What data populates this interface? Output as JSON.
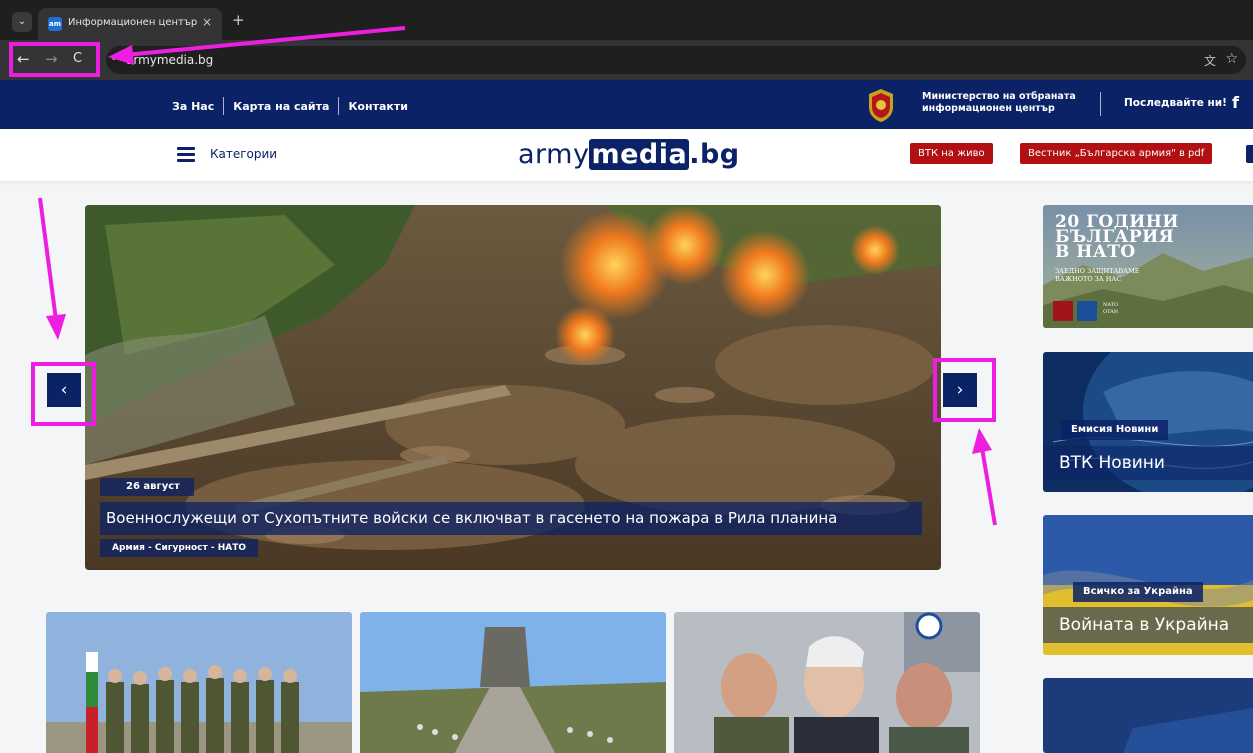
{
  "browser": {
    "tab_title": "Информационен център на М",
    "tab_close": "×",
    "new_tab": "+",
    "tab_menu": "⌄",
    "back": "←",
    "forward": "→",
    "reload": "C",
    "site_info": "⚯",
    "url": "armymedia.bg",
    "translate_icon": "文",
    "star_icon": "☆"
  },
  "topbar": {
    "links": [
      "За Нас",
      "Карта на сайта",
      "Контакти"
    ],
    "ministry_line1": "Министерство на отбраната",
    "ministry_line2": "информационен център",
    "follow": "Последвайте ни!",
    "facebook": "f"
  },
  "header": {
    "categories": "Категории",
    "logo_pre": "army",
    "logo_mid": "media",
    "logo_post": ".bg",
    "btn_live": "ВТК на живо",
    "btn_pdf": "Вестник „Българска армия\" в pdf"
  },
  "hero": {
    "date": "26 август",
    "headline": "Военнослужещи от Сухопътните войски се включват в гасенето на пожара в Рила планина",
    "category": "Армия - Сигурност - НАТО",
    "prev": "‹",
    "next": "›"
  },
  "sidebar": {
    "nato": {
      "line1": "20 ГОДИНИ",
      "line2": "БЪЛГАРИЯ",
      "line3": "В НАТО",
      "sub1": "ЗАЕДНО ЗАЩИТАВАМЕ",
      "sub2": "ВАЖНОТО ЗА НАС",
      "badge1": "NATO",
      "badge2": "OTAN"
    },
    "vtk": {
      "chip": "Емисия Новини",
      "title": "ВТК Новини"
    },
    "ukraine": {
      "chip": "Всичко за Украйна",
      "title": "Войната в Украйна"
    }
  },
  "colors": {
    "brand_navy": "#0b2266",
    "brand_red": "#b20f12",
    "annotation_magenta": "#ec1ee0"
  }
}
